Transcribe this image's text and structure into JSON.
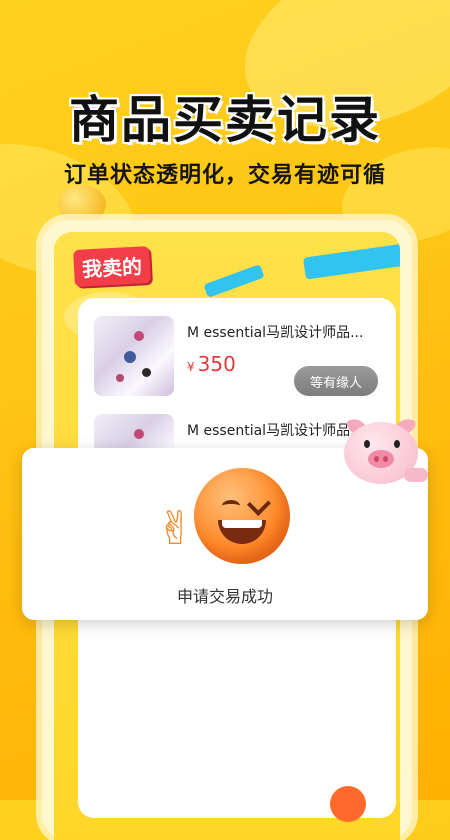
{
  "headline": "商品买卖记录",
  "subline": "订单状态透明化，交易有迹可循",
  "phone": {
    "tab_label": "我卖的",
    "items": [
      {
        "title": "M essential马凯设计师品...",
        "currency": "¥",
        "price": "350",
        "status": "等有缘人"
      },
      {
        "title": "M essential马凯设计师品..."
      }
    ]
  },
  "popup": {
    "message": "申请交易成功",
    "icons": [
      "victory-hand-icon",
      "winking-face-icon"
    ]
  },
  "colors": {
    "accent": "#ffc21a",
    "price": "#e4393c",
    "tab_label_bg": "#f33e49"
  }
}
